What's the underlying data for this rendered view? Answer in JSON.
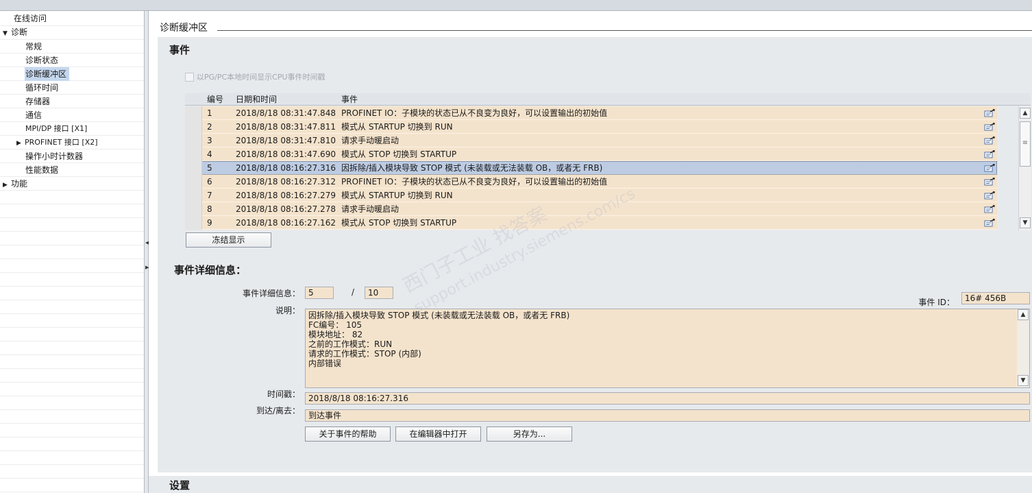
{
  "nav": {
    "online_access": "在线访问",
    "diagnostics": "诊断",
    "general": "常规",
    "diag_status": "诊断状态",
    "diag_buffer": "诊断缓冲区",
    "cycle_time": "循环时间",
    "memory": "存储器",
    "communication": "通信",
    "mpi_dp": "MPI/DP 接口 [X1]",
    "profinet": "PROFINET 接口 [X2]",
    "operating_hours": "操作小时计数器",
    "performance": "性能数据",
    "functions": "功能"
  },
  "main": {
    "title": "诊断缓冲区",
    "events_heading": "事件",
    "checkbox_label": "以PG/PC本地时间显示CPU事件时间戳",
    "freeze_button": "冻结显示",
    "details_heading": "事件详细信息：",
    "settings_heading": "设置"
  },
  "table": {
    "columns": {
      "num": "编号",
      "datetime": "日期和时间",
      "event": "事件"
    },
    "rows": [
      {
        "num": "1",
        "datetime": "2018/8/18 08:31:47.848",
        "event": "PROFINET IO：子模块的状态已从不良变为良好，可以设置输出的初始值"
      },
      {
        "num": "2",
        "datetime": "2018/8/18 08:31:47.811",
        "event": "模式从 STARTUP 切换到 RUN"
      },
      {
        "num": "3",
        "datetime": "2018/8/18 08:31:47.810",
        "event": "请求手动暖启动"
      },
      {
        "num": "4",
        "datetime": "2018/8/18 08:31:47.690",
        "event": "模式从 STOP 切换到 STARTUP"
      },
      {
        "num": "5",
        "datetime": "2018/8/18 08:16:27.316",
        "event": "因拆除/插入模块导致 STOP 模式 (未装载或无法装载 OB，或者无 FRB)"
      },
      {
        "num": "6",
        "datetime": "2018/8/18 08:16:27.312",
        "event": "PROFINET IO：子模块的状态已从不良变为良好，可以设置输出的初始值"
      },
      {
        "num": "7",
        "datetime": "2018/8/18 08:16:27.279",
        "event": "模式从 STARTUP 切换到 RUN"
      },
      {
        "num": "8",
        "datetime": "2018/8/18 08:16:27.278",
        "event": "请求手动暖启动"
      },
      {
        "num": "9",
        "datetime": "2018/8/18 08:16:27.162",
        "event": "模式从 STOP 切换到 STARTUP"
      }
    ]
  },
  "details": {
    "detail_label": "事件详细信息：",
    "detail_index": "5",
    "separator": "/",
    "detail_total": "10",
    "event_id_label": "事件 ID：",
    "event_id": "16# 456B",
    "description_label": "说明：",
    "description_lines": [
      "因拆除/插入模块导致 STOP 模式 (未装载或无法装载 OB，或者无 FRB)",
      "FC编号：  105",
      "模块地址：   82",
      "之前的工作模式：RUN",
      "请求的工作模式：STOP (内部)",
      "内部错误"
    ],
    "timestamp_label": "时间戳：",
    "timestamp": "2018/8/18 08:16:27.316",
    "coming_going_label": "到达/离去：",
    "coming_going": "到达事件",
    "help_button": "关于事件的帮助",
    "open_editor_button": "在编辑器中打开",
    "save_as_button": "另存为..."
  },
  "watermark": {
    "line1": "西门子工业  找答案",
    "line2": "support.industry.siemens.com/cs"
  },
  "colors": {
    "row_bg": "#f4e3cc",
    "selected_row": "#bdcce3",
    "panel_bg": "#e7eaed"
  }
}
